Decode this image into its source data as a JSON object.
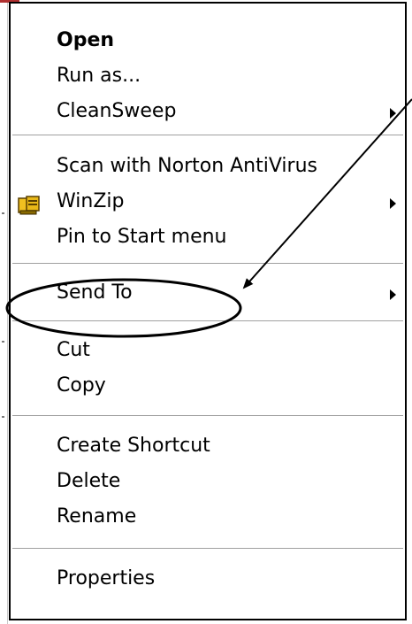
{
  "menu": {
    "items": [
      {
        "label": "Open",
        "bold": true,
        "submenu": false
      },
      {
        "label": "Run as...",
        "bold": false,
        "submenu": false
      },
      {
        "label": "CleanSweep",
        "bold": false,
        "submenu": true
      },
      {
        "label": "Scan with Norton AntiVirus",
        "bold": false,
        "submenu": false
      },
      {
        "label": "WinZip",
        "bold": false,
        "submenu": true,
        "icon": "winzip-icon"
      },
      {
        "label": "Pin to Start menu",
        "bold": false,
        "submenu": false
      },
      {
        "label": "Send To",
        "bold": false,
        "submenu": true
      },
      {
        "label": "Cut",
        "bold": false,
        "submenu": false
      },
      {
        "label": "Copy",
        "bold": false,
        "submenu": false
      },
      {
        "label": "Create Shortcut",
        "bold": false,
        "submenu": false
      },
      {
        "label": "Delete",
        "bold": false,
        "submenu": false
      },
      {
        "label": "Rename",
        "bold": false,
        "submenu": false
      },
      {
        "label": "Properties",
        "bold": false,
        "submenu": false
      }
    ]
  },
  "annotation": {
    "highlighted_item": "Send To",
    "color": "#000000"
  }
}
